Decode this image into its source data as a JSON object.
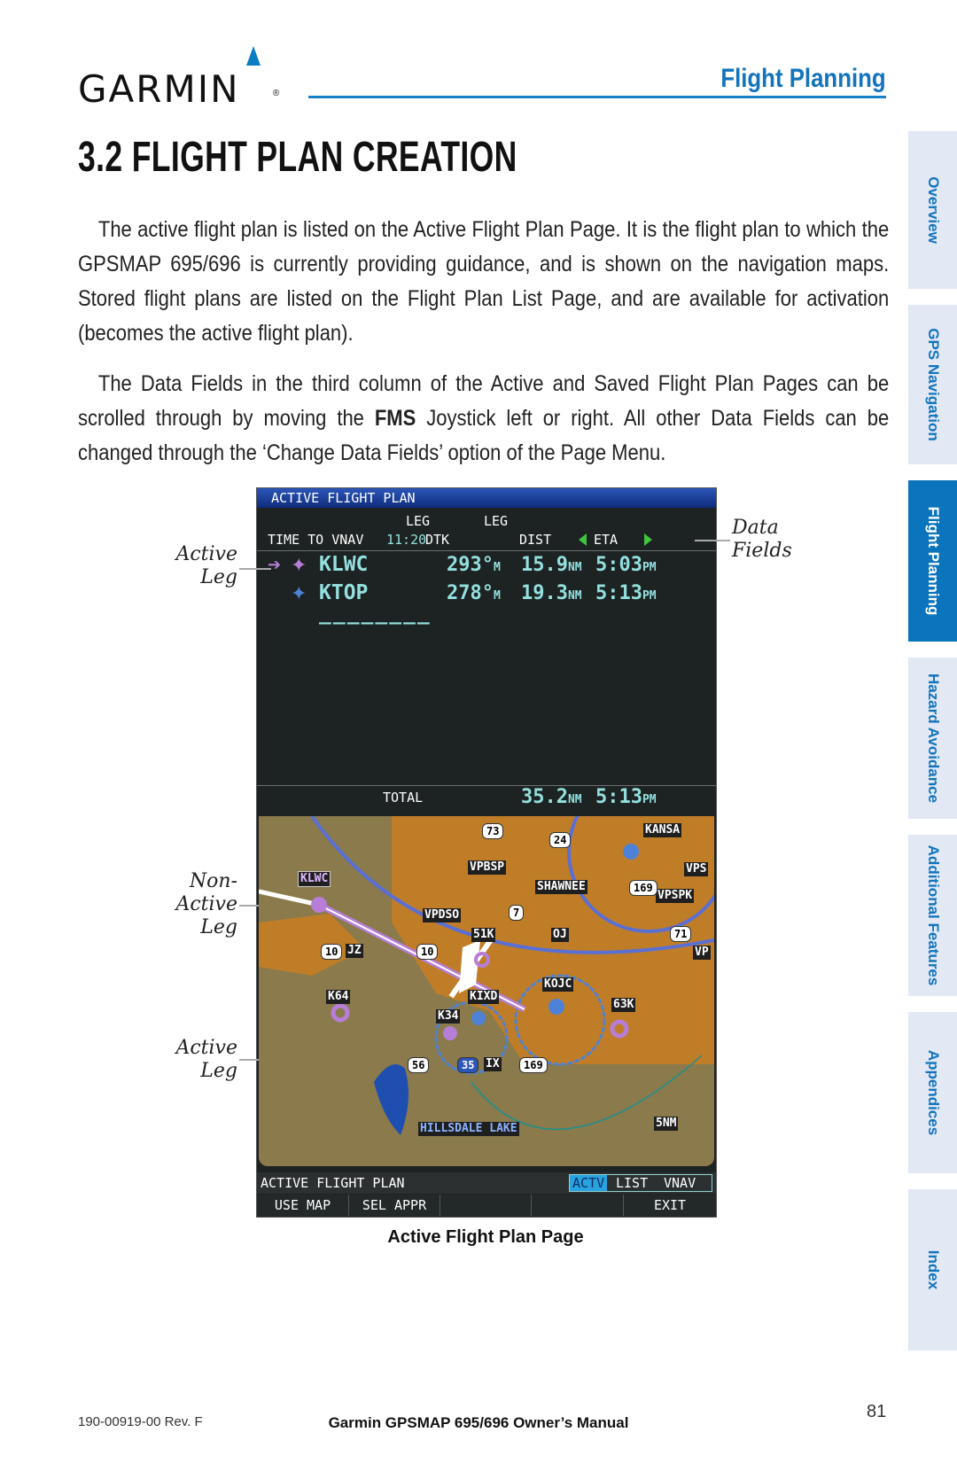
{
  "header": {
    "brand": "GARMIN",
    "brand_registered": "®",
    "section": "Flight Planning"
  },
  "chapter": {
    "title": "3.2  FLIGHT PLAN CREATION"
  },
  "paragraphs": {
    "p1": "The active flight plan is listed on the Active Flight Plan Page.  It is the flight plan to which the GPSMAP 695/696 is currently providing guidance, and is shown on the navigation maps.  Stored flight plans are listed on the Flight Plan List Page, and are available for activation (becomes the active flight plan).",
    "p2_before": "The Data Fields in the third column of the Active and Saved Flight Plan Pages can be scrolled through by moving the ",
    "p2_bold": "FMS",
    "p2_after": " Joystick left or right.  All other Data Fields can be changed through the ‘Change Data Fields’ option of the Page Menu."
  },
  "side_tabs": [
    {
      "label": "Overview",
      "active": false
    },
    {
      "label": "GPS Navigation",
      "active": false
    },
    {
      "label": "Flight Planning",
      "active": true
    },
    {
      "label": "Hazard Avoidance",
      "active": false
    },
    {
      "label": "Additional Features",
      "active": false
    },
    {
      "label": "Appendices",
      "active": false
    },
    {
      "label": "Index",
      "active": false
    }
  ],
  "screen": {
    "title": "ACTIVE FLIGHT PLAN",
    "time_to_vnav_label": "TIME TO VNAV",
    "time_to_vnav_value": "11:20",
    "col_dtk_top": "LEG",
    "col_dtk": "DTK",
    "col_dist_top": "LEG",
    "col_dist": "DIST",
    "col_eta": "ETA",
    "rows": [
      {
        "id": "KLWC",
        "dtk": "293°",
        "dtk_unit": "M",
        "dist": "15.9",
        "dist_unit": "NM",
        "eta": "5:03",
        "eta_unit": "PM",
        "active": true
      },
      {
        "id": "KTOP",
        "dtk": "278°",
        "dtk_unit": "M",
        "dist": "19.3",
        "dist_unit": "NM",
        "eta": "5:13",
        "eta_unit": "PM",
        "active": false
      }
    ],
    "empty_row": "________",
    "total_label": "TOTAL",
    "total_dist": "35.2",
    "total_dist_unit": "NM",
    "total_eta": "5:13",
    "total_eta_unit": "PM",
    "map_labels": {
      "klwc": "KLWC",
      "vpbsp": "VPBSP",
      "shawnee": "SHAWNEE",
      "vpspk": "VPSPK",
      "kansas": "KANSA",
      "vpdso": "VPDSO",
      "k51": "51K",
      "oj": "OJ",
      "jz": "JZ",
      "k64": "K64",
      "kixd": "KIXD",
      "kojc": "KOJC",
      "k63": "63K",
      "k34": "K34",
      "ix": "IX",
      "hillsdale": "HILLSDALE LAKE",
      "vps": "VPS",
      "vp": "VP",
      "scale": "5NM"
    },
    "shields": [
      "73",
      "24",
      "169",
      "7",
      "10",
      "10",
      "71",
      "56",
      "35",
      "169"
    ],
    "status_bar": {
      "page_name": "ACTIVE FLIGHT PLAN",
      "tabs": [
        "ACTV",
        "LIST",
        "VNAV"
      ],
      "active_tab": "ACTV"
    },
    "softkeys": [
      "USE MAP",
      "SEL APPR",
      "",
      "",
      "EXIT"
    ]
  },
  "callouts": {
    "active_leg_top": [
      "Active",
      "Leg"
    ],
    "data_fields": [
      "Data",
      "Fields"
    ],
    "non_active_leg": [
      "Non-",
      "Active",
      "Leg"
    ],
    "active_leg_bottom": [
      "Active",
      "Leg"
    ]
  },
  "caption": "Active Flight Plan Page",
  "footer": {
    "doc_number": "190-00919-00 Rev. F",
    "title": "Garmin GPSMAP 695/696 Owner’s Manual",
    "page": "81"
  }
}
